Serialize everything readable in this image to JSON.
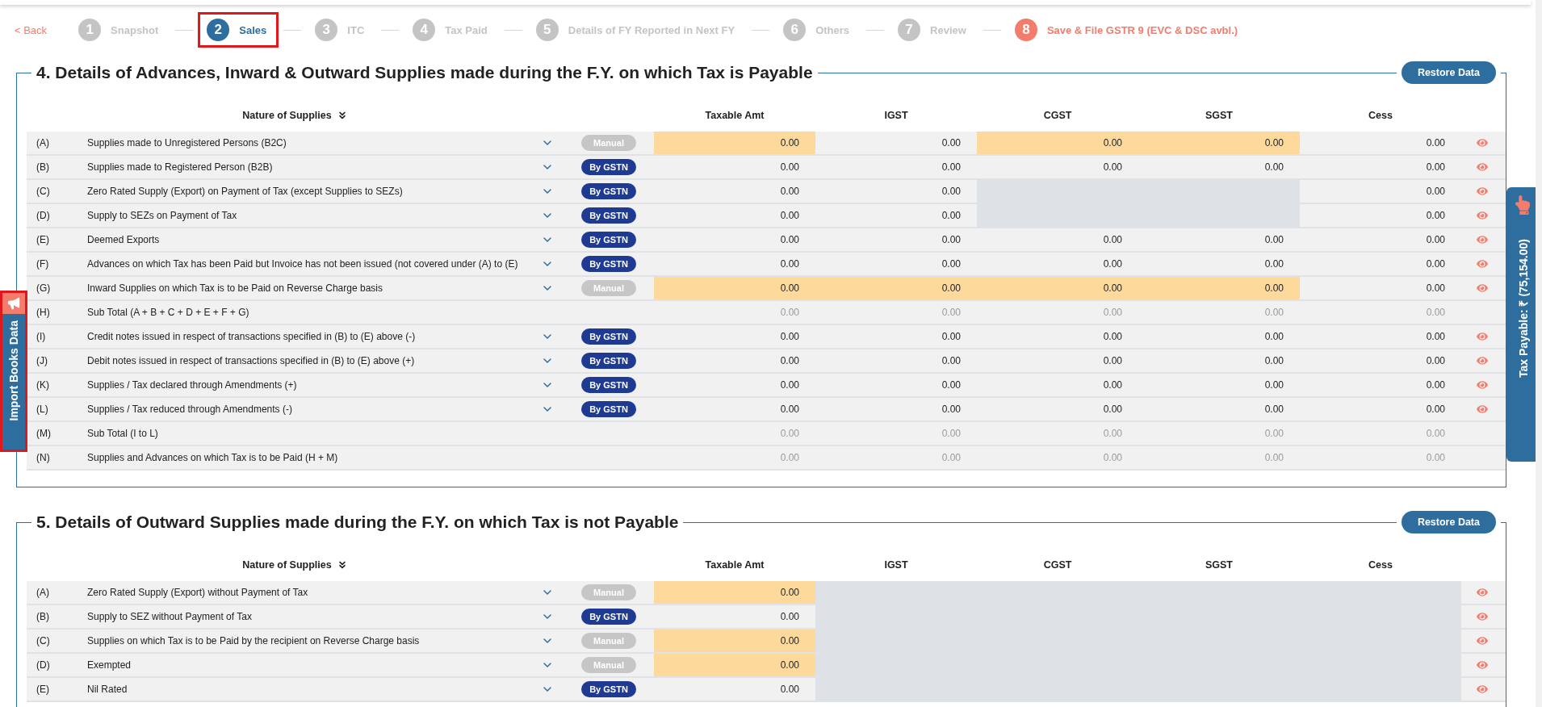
{
  "back_link": "< Back",
  "steps": [
    {
      "number": "1",
      "label": "Snapshot",
      "kind": "step",
      "selected": false,
      "highlighted": false
    },
    {
      "number": "2",
      "label": "Sales",
      "kind": "step",
      "selected": true,
      "highlighted": true
    },
    {
      "number": "3",
      "label": "ITC",
      "kind": "step",
      "selected": false,
      "highlighted": false
    },
    {
      "number": "4",
      "label": "Tax Paid",
      "kind": "step",
      "selected": false,
      "highlighted": false
    },
    {
      "number": "5",
      "label": "Details of FY Reported in Next FY",
      "kind": "step",
      "selected": false,
      "highlighted": false
    },
    {
      "number": "6",
      "label": "Others",
      "kind": "step",
      "selected": false,
      "highlighted": false
    },
    {
      "number": "7",
      "label": "Review",
      "kind": "step",
      "selected": false,
      "highlighted": false
    },
    {
      "number": "8",
      "label": "Save & File GSTR 9 (EVC & DSC avbl.)",
      "kind": "submit",
      "selected": false,
      "highlighted": false
    }
  ],
  "import_tab": {
    "label": "Import Books Data",
    "highlighted": true
  },
  "tax_tab": {
    "label": "Tax Payable: ₹ (75,154.00)"
  },
  "sections": [
    {
      "title": "4. Details of Advances, Inward & Outward Supplies made during the F.Y. on which Tax is Payable",
      "restore_button": "Restore Data",
      "columns": [
        "Nature of Supplies",
        "Taxable Amt",
        "IGST",
        "CGST",
        "SGST",
        "Cess"
      ],
      "rows": [
        {
          "code": "(A)",
          "description": "Supplies made to Unregistered Persons (B2C)",
          "badge": {
            "label": "Manual",
            "kind": "manual"
          },
          "viewable": true,
          "cells": [
            {
              "kind": "input",
              "value": "0.00"
            },
            {
              "kind": "plain",
              "value": "0.00"
            },
            {
              "kind": "input",
              "value": "0.00"
            },
            {
              "kind": "input",
              "value": "0.00"
            },
            {
              "kind": "plain",
              "value": "0.00"
            }
          ]
        },
        {
          "code": "(B)",
          "description": "Supplies made to Registered Person (B2B)",
          "badge": {
            "label": "By GSTN",
            "kind": "gstn"
          },
          "viewable": true,
          "cells": [
            {
              "kind": "plain",
              "value": "0.00"
            },
            {
              "kind": "plain",
              "value": "0.00"
            },
            {
              "kind": "plain",
              "value": "0.00"
            },
            {
              "kind": "plain",
              "value": "0.00"
            },
            {
              "kind": "plain",
              "value": "0.00"
            }
          ]
        },
        {
          "code": "(C)",
          "description": "Zero Rated Supply (Export) on Payment of Tax (except Supplies to SEZs)",
          "badge": {
            "label": "By GSTN",
            "kind": "gstn"
          },
          "viewable": true,
          "cells": [
            {
              "kind": "plain",
              "value": "0.00"
            },
            {
              "kind": "plain",
              "value": "0.00"
            },
            {
              "kind": "disabled"
            },
            {
              "kind": "disabled"
            },
            {
              "kind": "plain",
              "value": "0.00"
            }
          ]
        },
        {
          "code": "(D)",
          "description": "Supply to SEZs on Payment of Tax",
          "badge": {
            "label": "By GSTN",
            "kind": "gstn"
          },
          "viewable": true,
          "cells": [
            {
              "kind": "plain",
              "value": "0.00"
            },
            {
              "kind": "plain",
              "value": "0.00"
            },
            {
              "kind": "disabled"
            },
            {
              "kind": "disabled"
            },
            {
              "kind": "plain",
              "value": "0.00"
            }
          ]
        },
        {
          "code": "(E)",
          "description": "Deemed Exports",
          "badge": {
            "label": "By GSTN",
            "kind": "gstn"
          },
          "viewable": true,
          "cells": [
            {
              "kind": "plain",
              "value": "0.00"
            },
            {
              "kind": "plain",
              "value": "0.00"
            },
            {
              "kind": "plain",
              "value": "0.00"
            },
            {
              "kind": "plain",
              "value": "0.00"
            },
            {
              "kind": "plain",
              "value": "0.00"
            }
          ]
        },
        {
          "code": "(F)",
          "description": "Advances on which Tax has been Paid but Invoice has not been issued (not covered under (A) to (E)",
          "badge": {
            "label": "By GSTN",
            "kind": "gstn"
          },
          "viewable": true,
          "cells": [
            {
              "kind": "plain",
              "value": "0.00"
            },
            {
              "kind": "plain",
              "value": "0.00"
            },
            {
              "kind": "plain",
              "value": "0.00"
            },
            {
              "kind": "plain",
              "value": "0.00"
            },
            {
              "kind": "plain",
              "value": "0.00"
            }
          ]
        },
        {
          "code": "(G)",
          "description": "Inward Supplies on which Tax is to be Paid on Reverse Charge basis",
          "badge": {
            "label": "Manual",
            "kind": "manual"
          },
          "viewable": true,
          "cells": [
            {
              "kind": "input",
              "value": "0.00"
            },
            {
              "kind": "input",
              "value": "0.00"
            },
            {
              "kind": "input",
              "value": "0.00"
            },
            {
              "kind": "input",
              "value": "0.00"
            },
            {
              "kind": "plain",
              "value": "0.00"
            }
          ]
        },
        {
          "code": "(H)",
          "description": "Sub Total (A + B + C + D + E + F + G)",
          "viewable": false,
          "cells": [
            {
              "kind": "computed",
              "value": "0.00"
            },
            {
              "kind": "computed",
              "value": "0.00"
            },
            {
              "kind": "computed",
              "value": "0.00"
            },
            {
              "kind": "computed",
              "value": "0.00"
            },
            {
              "kind": "computed",
              "value": "0.00"
            }
          ]
        },
        {
          "code": "(I)",
          "description": "Credit notes issued in respect of transactions specified in (B) to (E) above (-)",
          "badge": {
            "label": "By GSTN",
            "kind": "gstn"
          },
          "viewable": true,
          "cells": [
            {
              "kind": "plain",
              "value": "0.00"
            },
            {
              "kind": "plain",
              "value": "0.00"
            },
            {
              "kind": "plain",
              "value": "0.00"
            },
            {
              "kind": "plain",
              "value": "0.00"
            },
            {
              "kind": "plain",
              "value": "0.00"
            }
          ]
        },
        {
          "code": "(J)",
          "description": "Debit notes issued in respect of transactions specified in (B) to (E) above (+)",
          "badge": {
            "label": "By GSTN",
            "kind": "gstn"
          },
          "viewable": true,
          "cells": [
            {
              "kind": "plain",
              "value": "0.00"
            },
            {
              "kind": "plain",
              "value": "0.00"
            },
            {
              "kind": "plain",
              "value": "0.00"
            },
            {
              "kind": "plain",
              "value": "0.00"
            },
            {
              "kind": "plain",
              "value": "0.00"
            }
          ]
        },
        {
          "code": "(K)",
          "description": "Supplies / Tax declared through Amendments (+)",
          "badge": {
            "label": "By GSTN",
            "kind": "gstn"
          },
          "viewable": true,
          "cells": [
            {
              "kind": "plain",
              "value": "0.00"
            },
            {
              "kind": "plain",
              "value": "0.00"
            },
            {
              "kind": "plain",
              "value": "0.00"
            },
            {
              "kind": "plain",
              "value": "0.00"
            },
            {
              "kind": "plain",
              "value": "0.00"
            }
          ]
        },
        {
          "code": "(L)",
          "description": "Supplies / Tax reduced through Amendments (-)",
          "badge": {
            "label": "By GSTN",
            "kind": "gstn"
          },
          "viewable": true,
          "cells": [
            {
              "kind": "plain",
              "value": "0.00"
            },
            {
              "kind": "plain",
              "value": "0.00"
            },
            {
              "kind": "plain",
              "value": "0.00"
            },
            {
              "kind": "plain",
              "value": "0.00"
            },
            {
              "kind": "plain",
              "value": "0.00"
            }
          ]
        },
        {
          "code": "(M)",
          "description": "Sub Total (I to L)",
          "viewable": false,
          "cells": [
            {
              "kind": "computed",
              "value": "0.00"
            },
            {
              "kind": "computed",
              "value": "0.00"
            },
            {
              "kind": "computed",
              "value": "0.00"
            },
            {
              "kind": "computed",
              "value": "0.00"
            },
            {
              "kind": "computed",
              "value": "0.00"
            }
          ]
        },
        {
          "code": "(N)",
          "description": "Supplies and Advances on which Tax is to be Paid (H + M)",
          "viewable": false,
          "cells": [
            {
              "kind": "computed",
              "value": "0.00"
            },
            {
              "kind": "computed",
              "value": "0.00"
            },
            {
              "kind": "computed",
              "value": "0.00"
            },
            {
              "kind": "computed",
              "value": "0.00"
            },
            {
              "kind": "computed",
              "value": "0.00"
            }
          ]
        }
      ]
    },
    {
      "title": "5. Details of Outward Supplies made during the F.Y. on which Tax is not Payable",
      "restore_button": "Restore Data",
      "columns": [
        "Nature of Supplies",
        "Taxable Amt",
        "IGST",
        "CGST",
        "SGST",
        "Cess"
      ],
      "rows": [
        {
          "code": "(A)",
          "description": "Zero Rated Supply (Export) without Payment of Tax",
          "badge": {
            "label": "Manual",
            "kind": "manual"
          },
          "viewable": true,
          "cells": [
            {
              "kind": "input",
              "value": "0.00"
            },
            {
              "kind": "disabled"
            },
            {
              "kind": "disabled"
            },
            {
              "kind": "disabled"
            },
            {
              "kind": "disabled"
            }
          ]
        },
        {
          "code": "(B)",
          "description": "Supply to SEZ without Payment of Tax",
          "badge": {
            "label": "By GSTN",
            "kind": "gstn"
          },
          "viewable": true,
          "cells": [
            {
              "kind": "plain",
              "value": "0.00"
            },
            {
              "kind": "disabled"
            },
            {
              "kind": "disabled"
            },
            {
              "kind": "disabled"
            },
            {
              "kind": "disabled"
            }
          ]
        },
        {
          "code": "(C)",
          "description": "Supplies on which Tax is to be Paid by the recipient on Reverse Charge basis",
          "badge": {
            "label": "Manual",
            "kind": "manual"
          },
          "viewable": true,
          "cells": [
            {
              "kind": "input",
              "value": "0.00"
            },
            {
              "kind": "disabled"
            },
            {
              "kind": "disabled"
            },
            {
              "kind": "disabled"
            },
            {
              "kind": "disabled"
            }
          ]
        },
        {
          "code": "(D)",
          "description": "Exempted",
          "badge": {
            "label": "Manual",
            "kind": "manual"
          },
          "viewable": true,
          "cells": [
            {
              "kind": "input",
              "value": "0.00"
            },
            {
              "kind": "disabled"
            },
            {
              "kind": "disabled"
            },
            {
              "kind": "disabled"
            },
            {
              "kind": "disabled"
            }
          ]
        },
        {
          "code": "(E)",
          "description": "Nil Rated",
          "badge": {
            "label": "By GSTN",
            "kind": "gstn"
          },
          "viewable": true,
          "cells": [
            {
              "kind": "plain",
              "value": "0.00"
            },
            {
              "kind": "disabled"
            },
            {
              "kind": "disabled"
            },
            {
              "kind": "disabled"
            },
            {
              "kind": "disabled"
            }
          ]
        }
      ]
    }
  ]
}
